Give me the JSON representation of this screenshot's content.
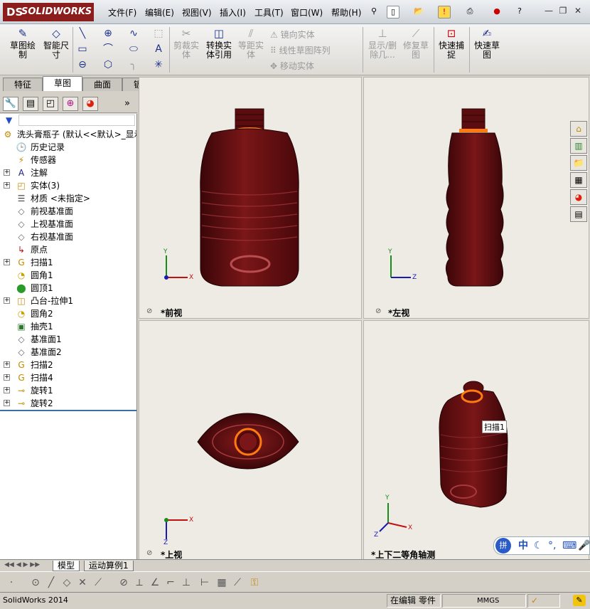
{
  "app": {
    "logo": "SOLIDWORKS",
    "logo_mark": "DS"
  },
  "menu": [
    "文件(F)",
    "编辑(E)",
    "视图(V)",
    "插入(I)",
    "工具(T)",
    "窗口(W)",
    "帮助(H)"
  ],
  "commands": {
    "sketch": "草图绘制",
    "smart_dim": "智能尺寸",
    "trim": "剪裁实体",
    "convert": "转换实体引用",
    "offset": "等距实体",
    "mirror": "镜向实体",
    "linear_pattern": "线性草图阵列",
    "move": "移动实体",
    "show_delete": "显示/删除几...",
    "repair": "修复草图",
    "quick_snap": "快速捕捉",
    "rapid_sketch": "快速草图"
  },
  "tabs": [
    "特征",
    "草图",
    "曲面",
    "钣金"
  ],
  "active_tab": 1,
  "tree": {
    "root": "洗头膏瓶子  (默认<<默认>_显示",
    "items": [
      {
        "label": "历史记录",
        "icon": "history-icon",
        "exp": false
      },
      {
        "label": "传感器",
        "icon": "sensor-icon",
        "exp": false
      },
      {
        "label": "注解",
        "icon": "annotation-icon",
        "exp": true
      },
      {
        "label": "实体(3)",
        "icon": "solid-body-icon",
        "exp": true
      },
      {
        "label": "材质 <未指定>",
        "icon": "material-icon",
        "exp": false
      },
      {
        "label": "前视基准面",
        "icon": "plane-icon",
        "exp": false
      },
      {
        "label": "上视基准面",
        "icon": "plane-icon",
        "exp": false
      },
      {
        "label": "右视基准面",
        "icon": "plane-icon",
        "exp": false
      },
      {
        "label": "原点",
        "icon": "origin-icon",
        "exp": false
      },
      {
        "label": "扫描1",
        "icon": "sweep-icon",
        "exp": true
      },
      {
        "label": "圆角1",
        "icon": "fillet-icon",
        "exp": false
      },
      {
        "label": "圆顶1",
        "icon": "dome-icon",
        "exp": false
      },
      {
        "label": "凸台-拉伸1",
        "icon": "extrude-icon",
        "exp": true
      },
      {
        "label": "圆角2",
        "icon": "fillet-icon",
        "exp": false
      },
      {
        "label": "抽壳1",
        "icon": "shell-icon",
        "exp": false
      },
      {
        "label": "基准面1",
        "icon": "plane-icon",
        "exp": false
      },
      {
        "label": "基准面2",
        "icon": "plane-icon",
        "exp": false
      },
      {
        "label": "扫描2",
        "icon": "sweep-icon",
        "exp": true
      },
      {
        "label": "扫描4",
        "icon": "sweep-icon",
        "exp": true
      },
      {
        "label": "旋转1",
        "icon": "revolve-icon",
        "exp": true
      },
      {
        "label": "旋转2",
        "icon": "revolve-icon",
        "exp": true
      }
    ]
  },
  "viewports": {
    "front": "*前视",
    "left": "*左视",
    "top": "*上视",
    "iso": "*上下二等角轴测",
    "tooltip": "扫描1"
  },
  "axes": {
    "x": "X",
    "y": "Y",
    "z": "Z"
  },
  "bottom_tabs": [
    "模型",
    "运动算例1"
  ],
  "status": {
    "app_name": "SolidWorks 2014",
    "mode": "在编辑 零件",
    "units": "MMGS"
  },
  "ime": {
    "text": "中"
  },
  "colors": {
    "bottle": "#7a1618",
    "accent": "#ff7a10",
    "ds_red": "#8c1d1d"
  }
}
